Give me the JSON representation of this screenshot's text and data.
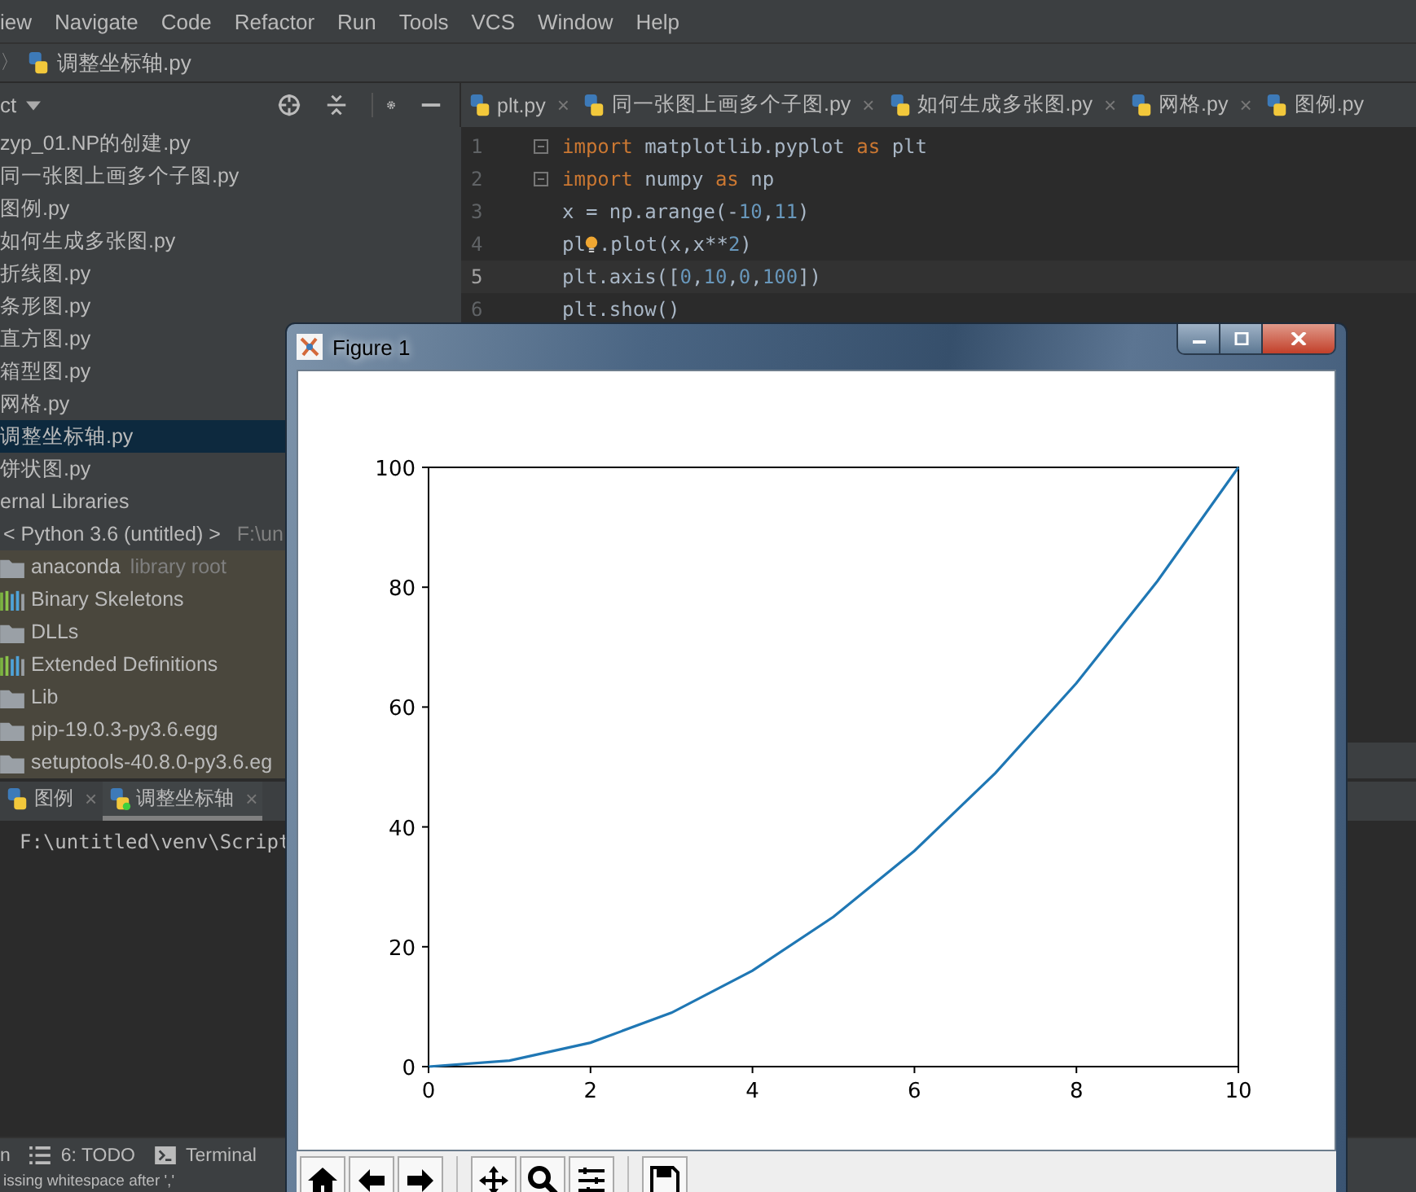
{
  "menu": [
    "iew",
    "Navigate",
    "Code",
    "Refactor",
    "Run",
    "Tools",
    "VCS",
    "Window",
    "Help"
  ],
  "breadcrumb": {
    "separator": "〉",
    "file": "调整坐标轴.py"
  },
  "project_header": {
    "label": "ct"
  },
  "editor_tabs": [
    {
      "label": "plt.py",
      "close": "×"
    },
    {
      "label": "同一张图上画多个子图.py",
      "close": "×"
    },
    {
      "label": "如何生成多张图.py",
      "close": "×"
    },
    {
      "label": "网格.py",
      "close": "×"
    },
    {
      "label": "图例.py"
    }
  ],
  "files": [
    {
      "label": "zyp_01.NP的创建.py",
      "selected": false
    },
    {
      "label": "同一张图上画多个子图.py",
      "selected": false
    },
    {
      "label": "图例.py",
      "selected": false
    },
    {
      "label": "如何生成多张图.py",
      "selected": false
    },
    {
      "label": "折线图.py",
      "selected": false
    },
    {
      "label": "条形图.py",
      "selected": false
    },
    {
      "label": "直方图.py",
      "selected": false
    },
    {
      "label": "箱型图.py",
      "selected": false
    },
    {
      "label": "网格.py",
      "selected": false
    },
    {
      "label": "调整坐标轴.py",
      "selected": true
    },
    {
      "label": "饼状图.py",
      "selected": false
    }
  ],
  "libraries": {
    "label": "ernal Libraries",
    "children": [
      {
        "label": "< Python 3.6 (untitled) >",
        "path": "F:\\un",
        "children": [
          {
            "label": "anaconda",
            "note": "library root",
            "kind": "folder"
          },
          {
            "label": "Binary Skeletons",
            "kind": "library"
          },
          {
            "label": "DLLs",
            "kind": "folder"
          },
          {
            "label": "Extended Definitions",
            "kind": "library"
          },
          {
            "label": "Lib",
            "kind": "folder"
          },
          {
            "label": "pip-19.0.3-py3.6.egg",
            "kind": "folder"
          },
          {
            "label": "setuptools-40.8.0-py3.6.eg",
            "kind": "folder"
          }
        ]
      }
    ]
  },
  "code": [
    {
      "number": "1",
      "fold": true,
      "current": false,
      "segments": [
        {
          "kind": "code",
          "tokens": [
            {
              "text": "import",
              "kind": "keyword"
            },
            {
              "text": " matplotlib.pyplot ",
              "kind": "plain"
            },
            {
              "text": "as",
              "kind": "keyword"
            },
            {
              "text": " plt",
              "kind": "plain"
            }
          ]
        }
      ]
    },
    {
      "number": "2",
      "fold": true,
      "current": false,
      "segments": [
        {
          "kind": "code",
          "tokens": [
            {
              "text": "import",
              "kind": "keyword"
            },
            {
              "text": " numpy ",
              "kind": "plain"
            },
            {
              "text": "as",
              "kind": "keyword"
            },
            {
              "text": " np",
              "kind": "plain"
            }
          ]
        }
      ]
    },
    {
      "number": "3",
      "fold": false,
      "current": false,
      "segments": [
        {
          "kind": "code",
          "tokens": [
            {
              "text": "x = np.arange(-",
              "kind": "plain"
            },
            {
              "text": "10",
              "kind": "number"
            },
            {
              "text": ",",
              "kind": "plain"
            },
            {
              "text": "11",
              "kind": "number"
            },
            {
              "text": ")",
              "kind": "plain"
            }
          ]
        }
      ]
    },
    {
      "number": "4",
      "fold": false,
      "current": false,
      "segments": [
        {
          "kind": "code",
          "tokens": [
            {
              "text": "pl",
              "kind": "plain"
            }
          ]
        },
        {
          "kind": "bulb"
        },
        {
          "kind": "code",
          "tokens": [
            {
              "text": ".plot(x,x**",
              "kind": "plain"
            },
            {
              "text": "2",
              "kind": "number"
            },
            {
              "text": ")",
              "kind": "plain"
            }
          ]
        }
      ]
    },
    {
      "number": "5",
      "fold": false,
      "current": true,
      "segments": [
        {
          "kind": "code",
          "tokens": [
            {
              "text": "plt.axis([",
              "kind": "plain"
            },
            {
              "text": "0",
              "kind": "number"
            },
            {
              "text": ",",
              "kind": "plain"
            },
            {
              "text": "10",
              "kind": "number"
            },
            {
              "text": ",",
              "kind": "plain"
            },
            {
              "text": "0",
              "kind": "number"
            },
            {
              "text": ",",
              "kind": "plain"
            },
            {
              "text": "100",
              "kind": "number"
            },
            {
              "text": "])",
              "kind": "plain"
            }
          ]
        }
      ]
    },
    {
      "number": "6",
      "fold": false,
      "current": false,
      "segments": [
        {
          "kind": "code",
          "tokens": [
            {
              "text": "plt.show()",
              "kind": "plain"
            }
          ]
        }
      ]
    }
  ],
  "run_tabs": [
    {
      "label": "图例",
      "close": "×",
      "running": false,
      "selected": false
    },
    {
      "label": "调整坐标轴",
      "close": "×",
      "running": true,
      "selected": true
    }
  ],
  "console": "F:\\untitled\\venv\\Script",
  "tool_buttons": [
    {
      "label": "n",
      "kind": "plain"
    },
    {
      "label": "6: TODO",
      "kind": "todo"
    },
    {
      "label": "Terminal",
      "kind": "terminal"
    }
  ],
  "status_bar": "issing whitespace after ','",
  "figure": {
    "title": "Figure 1",
    "chart_data": {
      "type": "line",
      "x": [
        0,
        1,
        2,
        3,
        4,
        5,
        6,
        7,
        8,
        9,
        10
      ],
      "series": [
        {
          "color": "#1f77b4",
          "values": [
            0,
            1,
            4,
            9,
            16,
            25,
            36,
            49,
            64,
            81,
            100
          ]
        }
      ],
      "xlim": [
        0,
        10
      ],
      "ylim": [
        0,
        100
      ],
      "xticks": [
        0,
        2,
        4,
        6,
        8,
        10
      ],
      "yticks": [
        0,
        20,
        40,
        60,
        80,
        100
      ]
    },
    "toolbar": [
      {
        "kind": "home"
      },
      {
        "kind": "back"
      },
      {
        "kind": "forward"
      },
      {
        "kind": "pan"
      },
      {
        "kind": "zoom"
      },
      {
        "kind": "configure"
      },
      {
        "kind": "save"
      }
    ]
  }
}
